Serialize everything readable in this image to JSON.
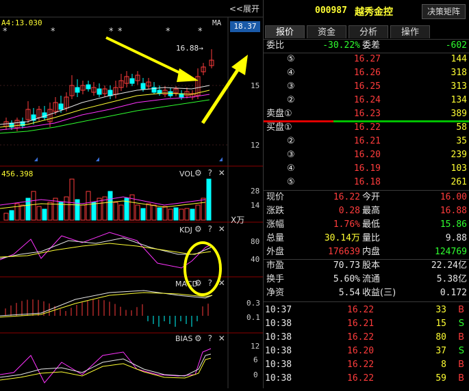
{
  "chart": {
    "collapse_label": "<<展开",
    "ma_value_label": "A4:13.030",
    "ma_label": "MA",
    "price_badge": "18.37",
    "high_annotation": "16.88→",
    "price_axis": [
      "15",
      "12"
    ],
    "vol_value_label": "456.398",
    "vol_label": "VOL",
    "vol_axis": [
      "28",
      "14"
    ],
    "vol_unit": "X万",
    "kdj_label": "KDJ",
    "kdj_axis": [
      "80",
      "40"
    ],
    "macd_label": "MACD",
    "macd_axis": [
      "0.3",
      "0.1"
    ],
    "bias_label": "BIAS",
    "bias_axis": [
      "12",
      "6",
      "0"
    ],
    "star_glyph": "*",
    "tool_glyphs": {
      "gear": "⚙",
      "help": "?",
      "close": "✕"
    }
  },
  "stock": {
    "code": "000987",
    "name": "越秀金控",
    "decision_button": "决策矩阵"
  },
  "tabs": [
    {
      "label": "报价",
      "active": true
    },
    {
      "label": "资金",
      "active": false
    },
    {
      "label": "分析",
      "active": false
    },
    {
      "label": "操作",
      "active": false
    }
  ],
  "order_book": {
    "weibi_label": "委比",
    "weibi_value": "-30.22%",
    "weicha_label": "委差",
    "weicha_value": "-602",
    "sell": [
      {
        "level": "⑤",
        "price": "16.27",
        "volume": "144"
      },
      {
        "level": "④",
        "price": "16.26",
        "volume": "318"
      },
      {
        "level": "③",
        "price": "16.25",
        "volume": "313"
      },
      {
        "level": "②",
        "price": "16.24",
        "volume": "134"
      },
      {
        "level": "卖盘①",
        "price": "16.23",
        "volume": "389"
      }
    ],
    "buy": [
      {
        "level": "买盘①",
        "price": "16.22",
        "volume": "58"
      },
      {
        "level": "②",
        "price": "16.21",
        "volume": "35"
      },
      {
        "level": "③",
        "price": "16.20",
        "volume": "239"
      },
      {
        "level": "④",
        "price": "16.19",
        "volume": "103"
      },
      {
        "level": "⑤",
        "price": "16.18",
        "volume": "261"
      }
    ]
  },
  "quote": {
    "xianjia_label": "现价",
    "xianjia": "16.22",
    "jinkai_label": "今开",
    "jinkai": "16.00",
    "zhangdie_label": "涨跌",
    "zhangdie": "0.28",
    "zuigao_label": "最高",
    "zuigao": "16.88",
    "zhangfu_label": "涨幅",
    "zhangfu": "1.76%",
    "zuidi_label": "最低",
    "zuidi": "15.86",
    "zongliang_label": "总量",
    "zongliang": "30.14万",
    "liangbi_label": "量比",
    "liangbi": "9.88",
    "waipan_label": "外盘",
    "waipan": "176639",
    "neipan_label": "内盘",
    "neipan": "124769",
    "shiying_label": "市盈",
    "shiying": "70.73",
    "guben_label": "股本",
    "guben": "22.24亿",
    "huanshou_label": "换手",
    "huanshou": "5.60%",
    "liutong_label": "流通",
    "liutong": "5.38亿",
    "jingzi_label": "净资",
    "jingzi": "5.54",
    "shouyi_label": "收益(三)",
    "shouyi": "0.172"
  },
  "ticks": [
    {
      "time": "10:37",
      "price": "16.22",
      "volume": "33",
      "side": "B"
    },
    {
      "time": "10:38",
      "price": "16.21",
      "volume": "15",
      "side": "S"
    },
    {
      "time": "10:38",
      "price": "16.22",
      "volume": "80",
      "side": "B"
    },
    {
      "time": "10:38",
      "price": "16.20",
      "volume": "37",
      "side": "S"
    },
    {
      "time": "10:38",
      "price": "16.22",
      "volume": "8",
      "side": "B"
    },
    {
      "time": "10:38",
      "price": "16.22",
      "volume": "59",
      "side": "B"
    }
  ],
  "colors": {
    "up": "#ff3c3c",
    "down": "#00ffff",
    "flat": "#e8e8e8",
    "green": "#2fff2f",
    "yellow": "#ffff33",
    "magenta": "#ff33ff"
  }
}
